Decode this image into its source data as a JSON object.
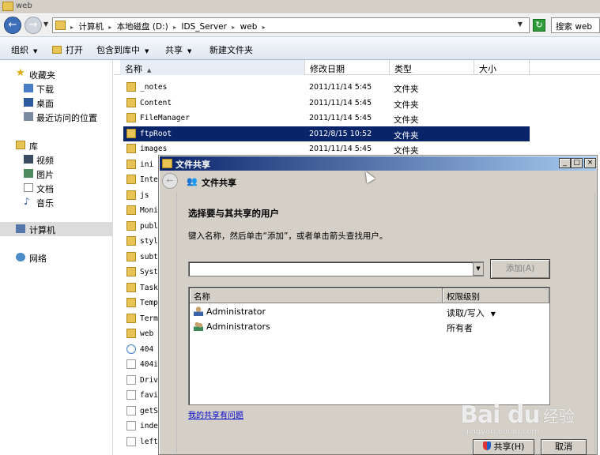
{
  "explorer": {
    "title": "web",
    "breadcrumb": [
      "计算机",
      "本地磁盘 (D:)",
      "IDS_Server",
      "web"
    ],
    "search_placeholder": "搜索 web",
    "toolbar": {
      "organize": "组织",
      "open": "打开",
      "include_in_library": "包含到库中",
      "share": "共享",
      "new_folder": "新建文件夹"
    },
    "nav": {
      "favorites": "收藏夹",
      "downloads": "下载",
      "desktop": "桌面",
      "recent": "最近访问的位置",
      "libraries": "库",
      "videos": "视频",
      "pictures": "图片",
      "documents": "文档",
      "music": "音乐",
      "computer": "计算机",
      "network": "网络"
    },
    "columns": {
      "name": "名称",
      "date": "修改日期",
      "type": "类型",
      "size": "大小"
    },
    "files": [
      {
        "name": "_notes",
        "date": "2011/11/14 5:45",
        "type": "文件夹",
        "icon": "folder"
      },
      {
        "name": "Content",
        "date": "2011/11/14 5:45",
        "type": "文件夹",
        "icon": "folder"
      },
      {
        "name": "FileManager",
        "date": "2011/11/14 5:45",
        "type": "文件夹",
        "icon": "folder"
      },
      {
        "name": "ftpRoot",
        "date": "2012/8/15 10:52",
        "type": "文件夹",
        "icon": "folder"
      },
      {
        "name": "images",
        "date": "2011/11/14 5:45",
        "type": "文件夹",
        "icon": "folder"
      },
      {
        "name": "ini",
        "date": "",
        "type": "",
        "icon": "folder"
      },
      {
        "name": "Inte",
        "date": "",
        "type": "",
        "icon": "folder"
      },
      {
        "name": "js",
        "date": "",
        "type": "",
        "icon": "folder"
      },
      {
        "name": "Moni",
        "date": "",
        "type": "",
        "icon": "folder"
      },
      {
        "name": "publ",
        "date": "",
        "type": "",
        "icon": "folder"
      },
      {
        "name": "styl",
        "date": "",
        "type": "",
        "icon": "folder"
      },
      {
        "name": "subt",
        "date": "",
        "type": "",
        "icon": "folder"
      },
      {
        "name": "Syst",
        "date": "",
        "type": "",
        "icon": "folder"
      },
      {
        "name": "Task",
        "date": "",
        "type": "",
        "icon": "folder"
      },
      {
        "name": "Temp",
        "date": "",
        "type": "",
        "icon": "folder"
      },
      {
        "name": "Term",
        "date": "",
        "type": "",
        "icon": "folder"
      },
      {
        "name": "web",
        "date": "",
        "type": "",
        "icon": "folder"
      },
      {
        "name": "404",
        "date": "",
        "type": "",
        "icon": "ie"
      },
      {
        "name": "404i",
        "date": "",
        "type": "",
        "icon": "file"
      },
      {
        "name": "Driv",
        "date": "",
        "type": "",
        "icon": "file"
      },
      {
        "name": "favi",
        "date": "",
        "type": "",
        "icon": "file"
      },
      {
        "name": "getS",
        "date": "",
        "type": "",
        "icon": "file"
      },
      {
        "name": "inde",
        "date": "",
        "type": "",
        "icon": "file"
      },
      {
        "name": "left",
        "date": "",
        "type": "",
        "icon": "file"
      }
    ],
    "selected_file": "ftpRoot"
  },
  "dialog": {
    "title": "文件共享",
    "heading": "文件共享",
    "prompt": "选择要与其共享的用户",
    "hint": "键入名称，然后单击“添加”，或者单击箭头查找用户。",
    "input_value": "",
    "add_button": "添加(A)",
    "table_headers": {
      "name": "名称",
      "permission": "权限级别"
    },
    "users": [
      {
        "name": "Administrator",
        "permission": "读取/写入",
        "icon": "user-icon"
      },
      {
        "name": "Administrators",
        "permission": "所有者",
        "icon": "group-icon"
      }
    ],
    "help_link": "我的共享有问题",
    "share_button": "共享(H)",
    "cancel_button": "取消",
    "window_controls": {
      "minimize": "_",
      "maximize": "□",
      "close": "×"
    }
  },
  "watermark": {
    "brand": "Bai du",
    "sub": "经验",
    "url": "jingyan.baidu.com"
  }
}
